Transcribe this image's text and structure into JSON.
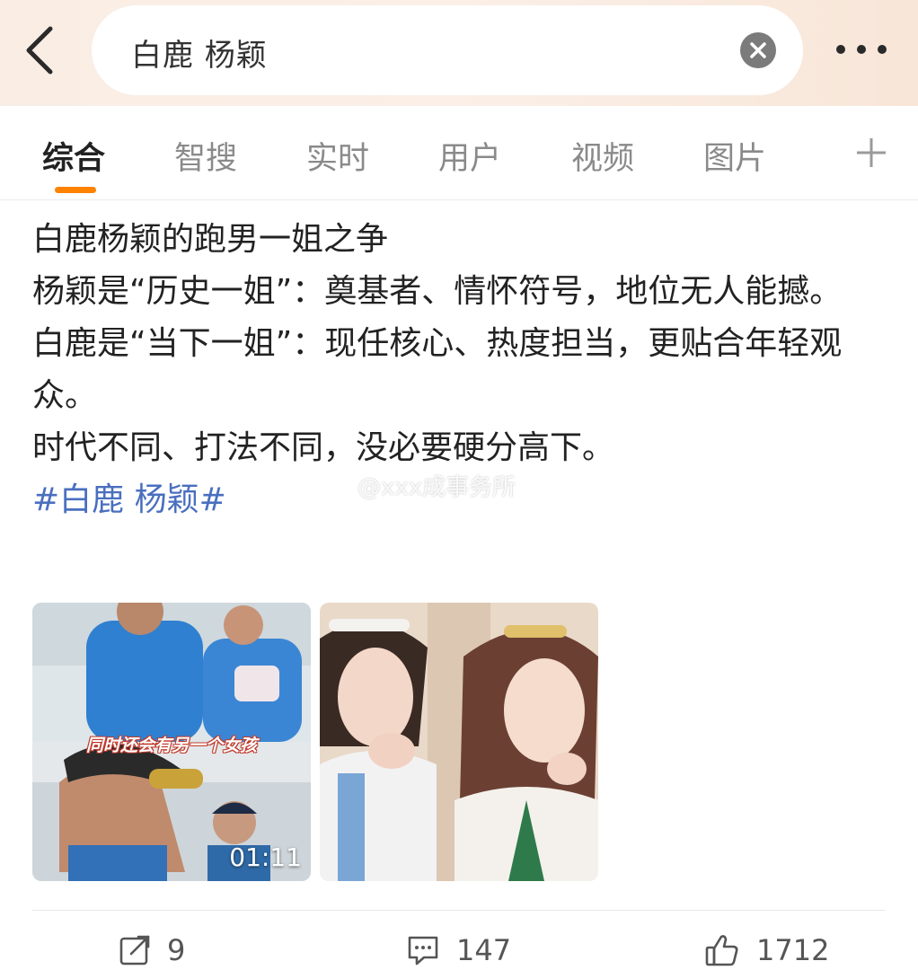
{
  "header": {
    "search_query": "白鹿 杨颖",
    "icons": {
      "back": "chevron-left-icon",
      "clear": "clear-icon",
      "more": "more-dots-icon"
    }
  },
  "tabs": [
    {
      "label": "综合",
      "active": true
    },
    {
      "label": "智搜",
      "active": false
    },
    {
      "label": "实时",
      "active": false
    },
    {
      "label": "用户",
      "active": false
    },
    {
      "label": "视频",
      "active": false
    },
    {
      "label": "图片",
      "active": false
    }
  ],
  "tab_add_icon": "plus-icon",
  "post": {
    "lines": [
      "白鹿杨颖的跑男一姐之争",
      "杨颖是“历史一姐”：奠基者、情怀符号，地位无人能撼。",
      "白鹿是“当下一姐”：现任核心、热度担当，更贴合年轻观众。",
      "时代不同、打法不同，没必要硬分高下。"
    ],
    "hashtag": "#白鹿 杨颖#",
    "watermark": "@xxx成事务所"
  },
  "media": {
    "video": {
      "duration": "01:11",
      "caption": "同时还会有另一个女孩"
    }
  },
  "actions": {
    "repost_count": "9",
    "comment_count": "147",
    "like_count": "1712",
    "icons": {
      "repost": "share-icon",
      "comment": "comment-icon",
      "like": "thumbs-up-icon"
    }
  },
  "colors": {
    "accent": "#ff8200",
    "hashtag": "#4a6fbf",
    "header_bg": "#f9ede4"
  }
}
